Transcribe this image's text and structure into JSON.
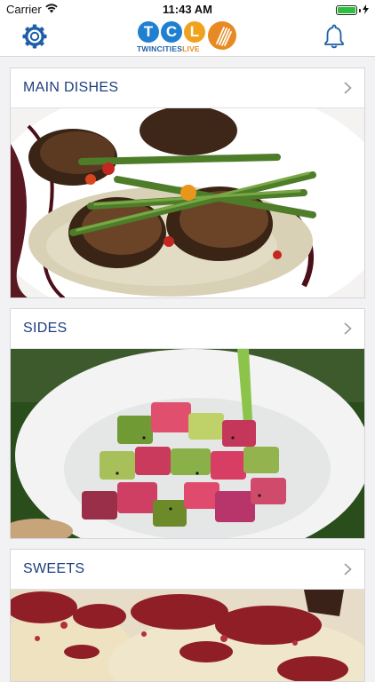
{
  "status_bar": {
    "carrier": "Carrier",
    "time": "11:43 AM",
    "battery_level": 1.0
  },
  "nav": {
    "settings_icon": "gear-icon",
    "notifications_icon": "bell-icon",
    "logo": {
      "letters": [
        "T",
        "C",
        "L"
      ],
      "subtitle_a": "TWINCITIES",
      "subtitle_b": "LIVE"
    }
  },
  "categories": [
    {
      "label": "MAIN DISHES",
      "image": "seared scallops with asparagus over risotto"
    },
    {
      "label": "SIDES",
      "image": "ahi tuna poke bowl with avocado"
    },
    {
      "label": "SWEETS",
      "image": "red velvet cake with cream frosting"
    }
  ],
  "colors": {
    "accent": "#1d3f7c",
    "logo_blue": "#1f5ea8",
    "logo_orange": "#e58a1f",
    "background": "#f2f2f4"
  }
}
